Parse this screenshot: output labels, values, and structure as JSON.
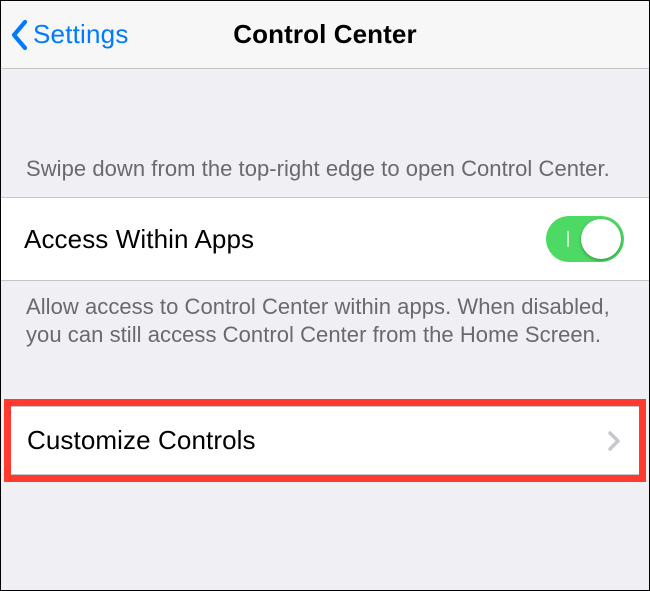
{
  "nav": {
    "back_label": "Settings",
    "title": "Control Center"
  },
  "section1": {
    "header": "Swipe down from the top-right edge to open Control Center.",
    "row_label": "Access Within Apps",
    "toggle_on": true,
    "footer": "Allow access to Control Center within apps. When disabled, you can still access Control Center from the Home Screen."
  },
  "section2": {
    "row_label": "Customize Controls"
  },
  "colors": {
    "link": "#007aff",
    "toggle_on": "#4cd964",
    "highlight": "#ff3a2f"
  }
}
